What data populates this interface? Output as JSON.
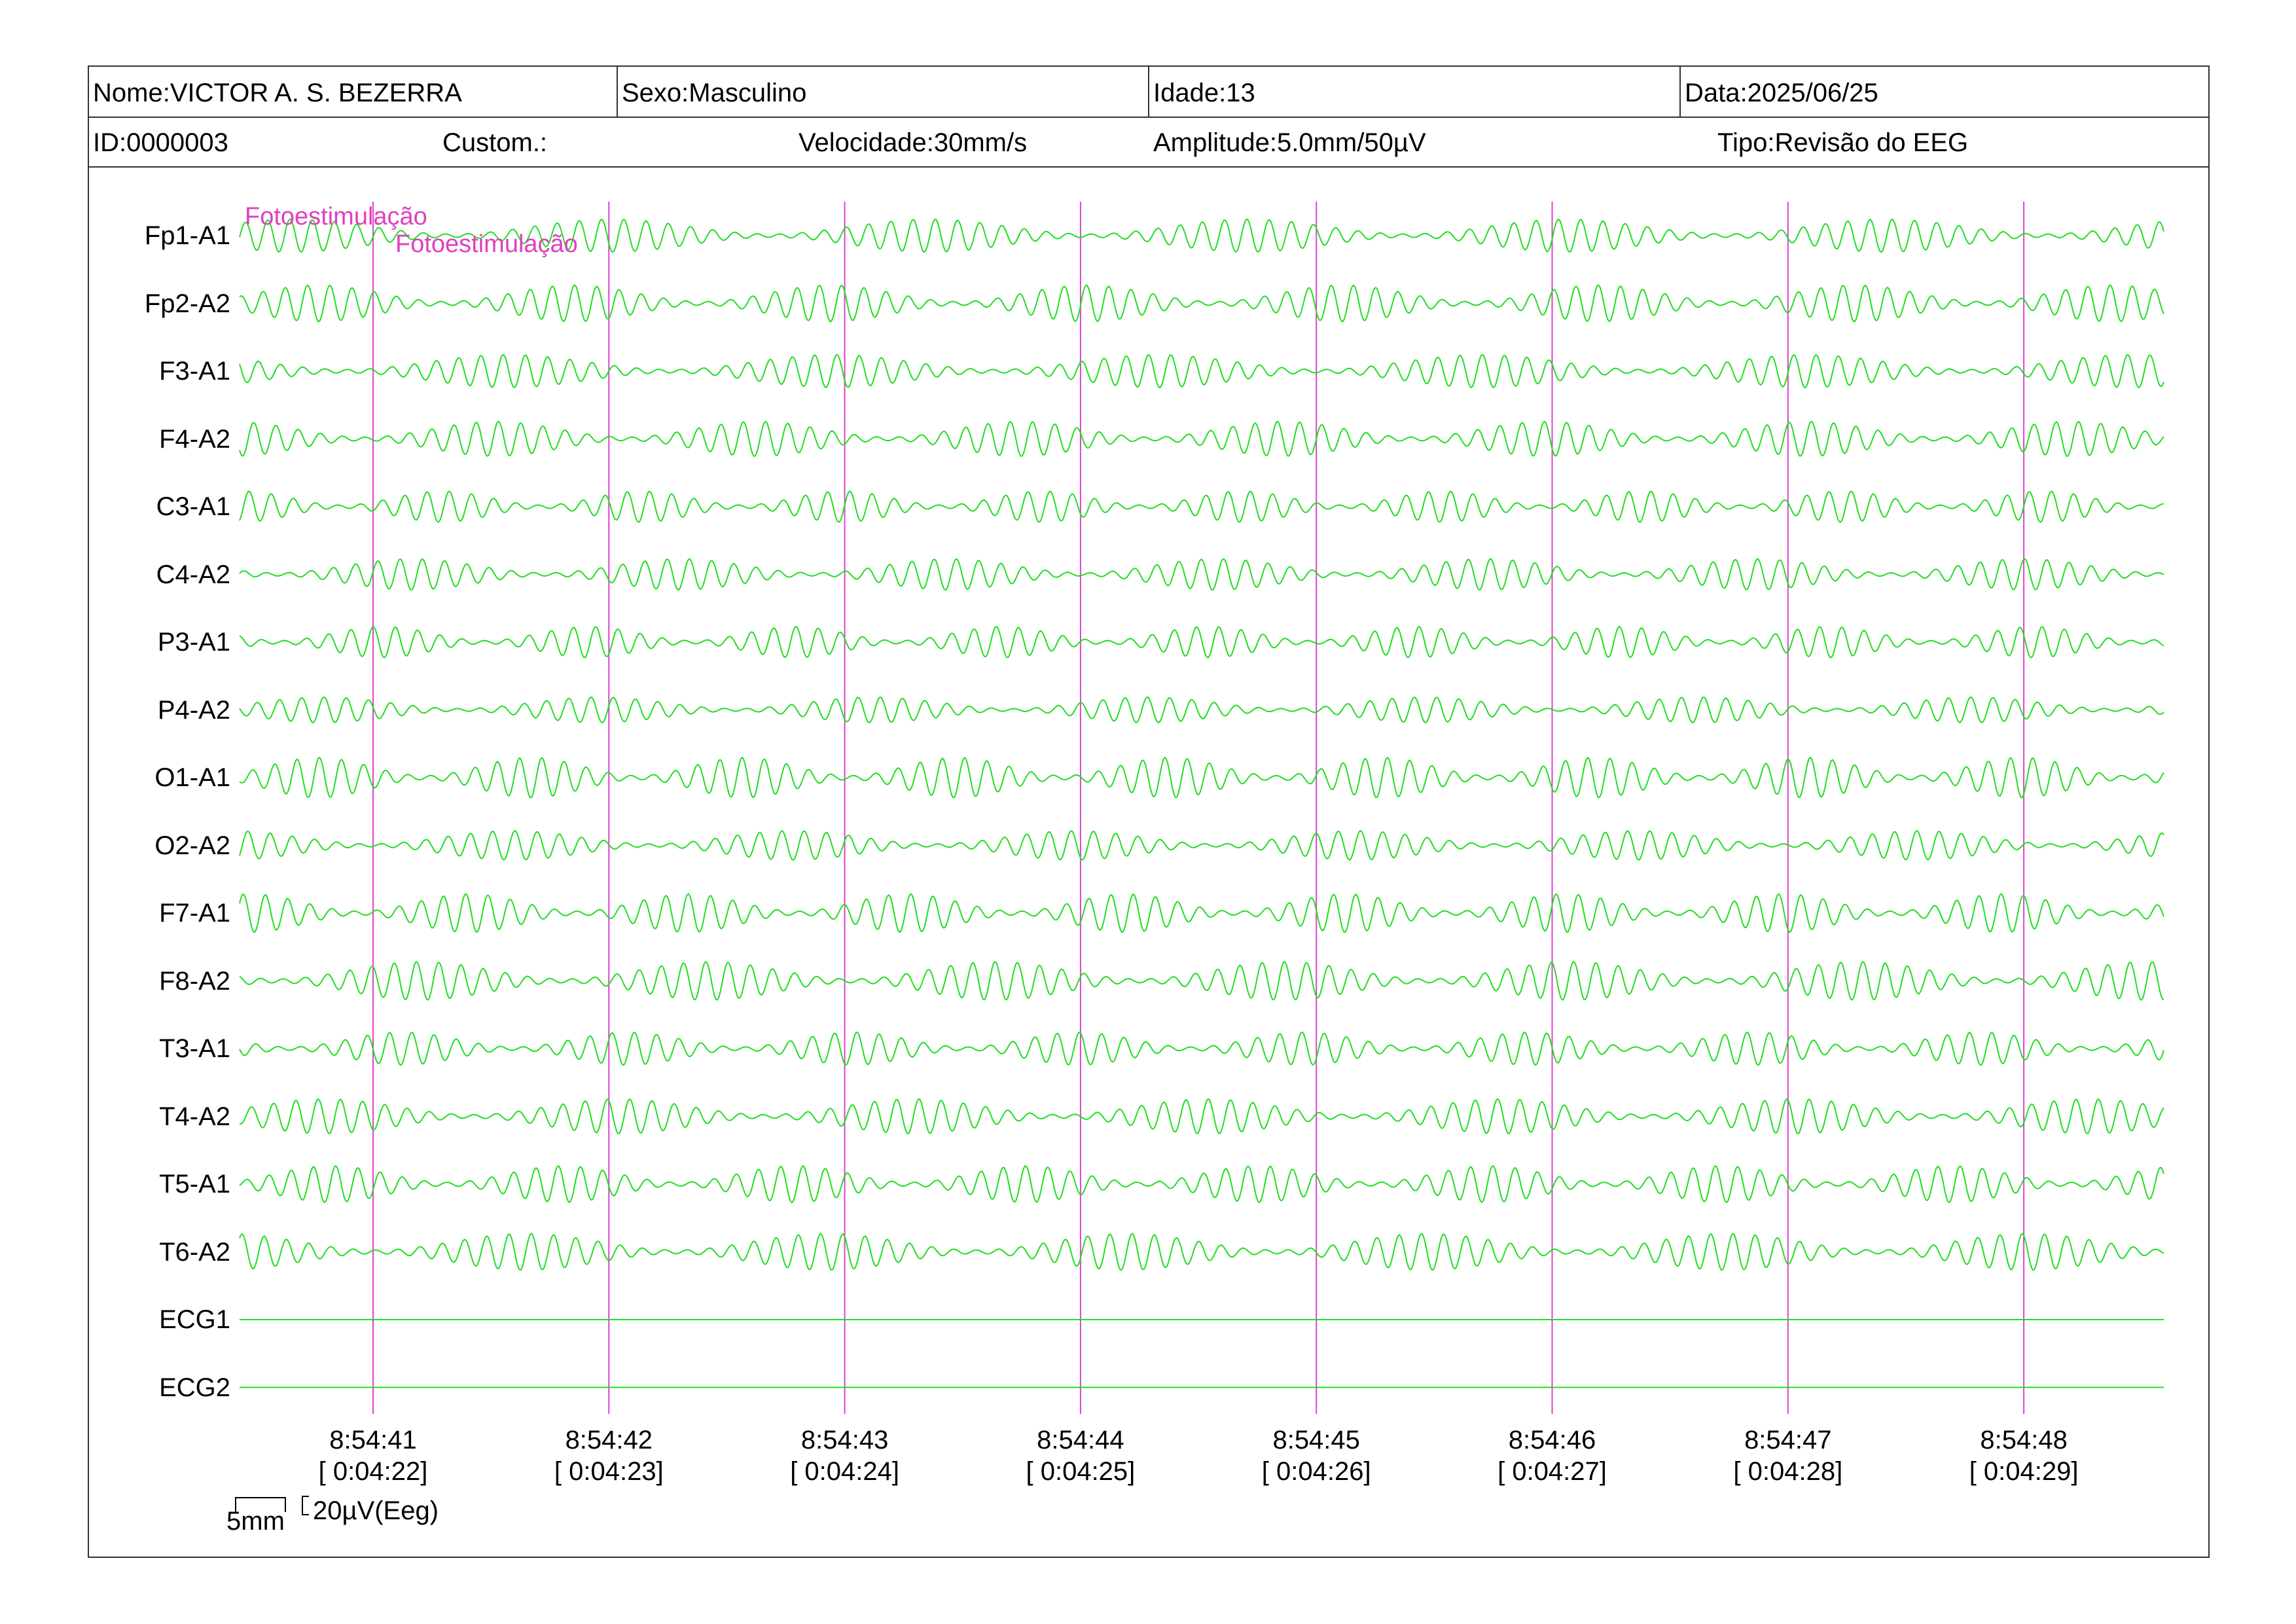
{
  "header": {
    "row1": [
      {
        "label": "Nome:VICTOR A. S. BEZERRA"
      },
      {
        "label": "Sexo:Masculino"
      },
      {
        "label": "Idade:13"
      },
      {
        "label": "Data:2025/06/25"
      }
    ],
    "row2": [
      {
        "label": "ID:0000003"
      },
      {
        "label": "Custom.:"
      },
      {
        "label": "Velocidade:30mm/s"
      },
      {
        "label": "Amplitude:5.0mm/50µV"
      },
      {
        "label": "Tipo:Revisão do EEG"
      }
    ]
  },
  "channels": [
    {
      "name": "Fp1-A1",
      "type": "eeg",
      "amp": 0.9
    },
    {
      "name": "Fp2-A2",
      "type": "eeg",
      "amp": 1.0
    },
    {
      "name": "F3-A1",
      "type": "eeg",
      "amp": 0.9
    },
    {
      "name": "F4-A2",
      "type": "eeg",
      "amp": 0.95
    },
    {
      "name": "C3-A1",
      "type": "eeg",
      "amp": 0.85
    },
    {
      "name": "C4-A2",
      "type": "eeg",
      "amp": 0.85
    },
    {
      "name": "P3-A1",
      "type": "eeg",
      "amp": 0.85
    },
    {
      "name": "P4-A2",
      "type": "eeg",
      "amp": 0.7
    },
    {
      "name": "O1-A1",
      "type": "eeg",
      "amp": 1.1
    },
    {
      "name": "O2-A2",
      "type": "eeg",
      "amp": 0.8
    },
    {
      "name": "F7-A1",
      "type": "eeg",
      "amp": 1.05
    },
    {
      "name": "F8-A2",
      "type": "eeg",
      "amp": 1.05
    },
    {
      "name": "T3-A1",
      "type": "eeg",
      "amp": 0.9
    },
    {
      "name": "T4-A2",
      "type": "eeg",
      "amp": 0.95
    },
    {
      "name": "T5-A1",
      "type": "eeg",
      "amp": 1.0
    },
    {
      "name": "T6-A2",
      "type": "eeg",
      "amp": 1.0
    },
    {
      "name": "ECG1",
      "type": "ecg",
      "amp": 0
    },
    {
      "name": "ECG2",
      "type": "ecg",
      "amp": 0
    }
  ],
  "time_marks": [
    {
      "clock": "8:54:41",
      "elapsed": "[ 0:04:22]"
    },
    {
      "clock": "8:54:42",
      "elapsed": "[ 0:04:23]"
    },
    {
      "clock": "8:54:43",
      "elapsed": "[ 0:04:24]"
    },
    {
      "clock": "8:54:44",
      "elapsed": "[ 0:04:25]"
    },
    {
      "clock": "8:54:45",
      "elapsed": "[ 0:04:26]"
    },
    {
      "clock": "8:54:46",
      "elapsed": "[ 0:04:27]"
    },
    {
      "clock": "8:54:47",
      "elapsed": "[ 0:04:28]"
    },
    {
      "clock": "8:54:48",
      "elapsed": "[ 0:04:29]"
    }
  ],
  "events": [
    {
      "label": "Fotoestimulação"
    },
    {
      "label": "Fotoestimulação"
    }
  ],
  "scale": {
    "horizontal": "5mm",
    "vertical": "20µV(Eeg)"
  },
  "colors": {
    "trace": "#22dd22",
    "marker": "#e040d0",
    "event_text": "#e040c0",
    "border": "#333333"
  }
}
